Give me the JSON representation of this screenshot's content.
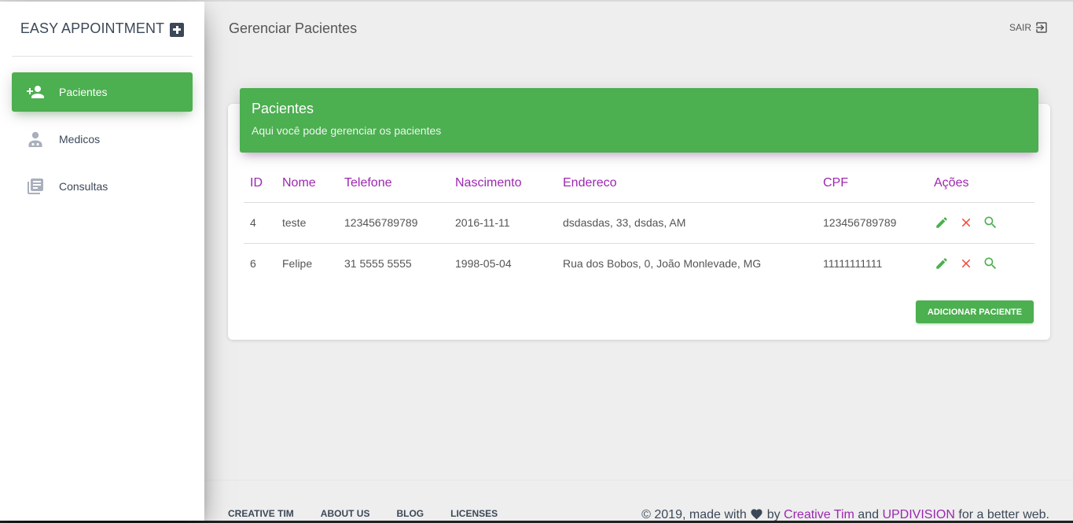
{
  "sidebar": {
    "brand": "EASY APPOINTMENT",
    "items": [
      {
        "label": "Pacientes",
        "icon": "person-add-icon",
        "active": true
      },
      {
        "label": "Medicos",
        "icon": "doctor-icon",
        "active": false
      },
      {
        "label": "Consultas",
        "icon": "library-books-icon",
        "active": false
      }
    ]
  },
  "header": {
    "title": "Gerenciar Pacientes",
    "logout_label": "SAIR"
  },
  "card": {
    "title": "Pacientes",
    "subtitle": "Aqui você pode gerenciar os pacientes",
    "columns": [
      "ID",
      "Nome",
      "Telefone",
      "Nascimento",
      "Endereco",
      "CPF",
      "Ações"
    ],
    "rows": [
      {
        "id": "4",
        "nome": "teste",
        "telefone": "123456789789",
        "nascimento": "2016-11-11",
        "endereco": "dsdasdas, 33, dsdas, AM",
        "cpf": "123456789789"
      },
      {
        "id": "6",
        "nome": "Felipe",
        "telefone": "31 5555 5555",
        "nascimento": "1998-05-04",
        "endereco": "Rua dos Bobos, 0, João Monlevade, MG",
        "cpf": "11111111111"
      }
    ],
    "add_button": "ADICIONAR PACIENTE"
  },
  "footer": {
    "links": [
      "CREATIVE TIM",
      "ABOUT US",
      "BLOG",
      "LICENSES"
    ],
    "copyright_prefix": "© 2019, made with",
    "copyright_by": "by",
    "creative_tim": "Creative Tim",
    "and": "and",
    "updivision": "UPDIVISION",
    "copyright_suffix": "for a better web."
  },
  "colors": {
    "accent": "#4caf50",
    "header_text": "#9c27b0",
    "edit": "#4caf50",
    "delete": "#f44336"
  }
}
